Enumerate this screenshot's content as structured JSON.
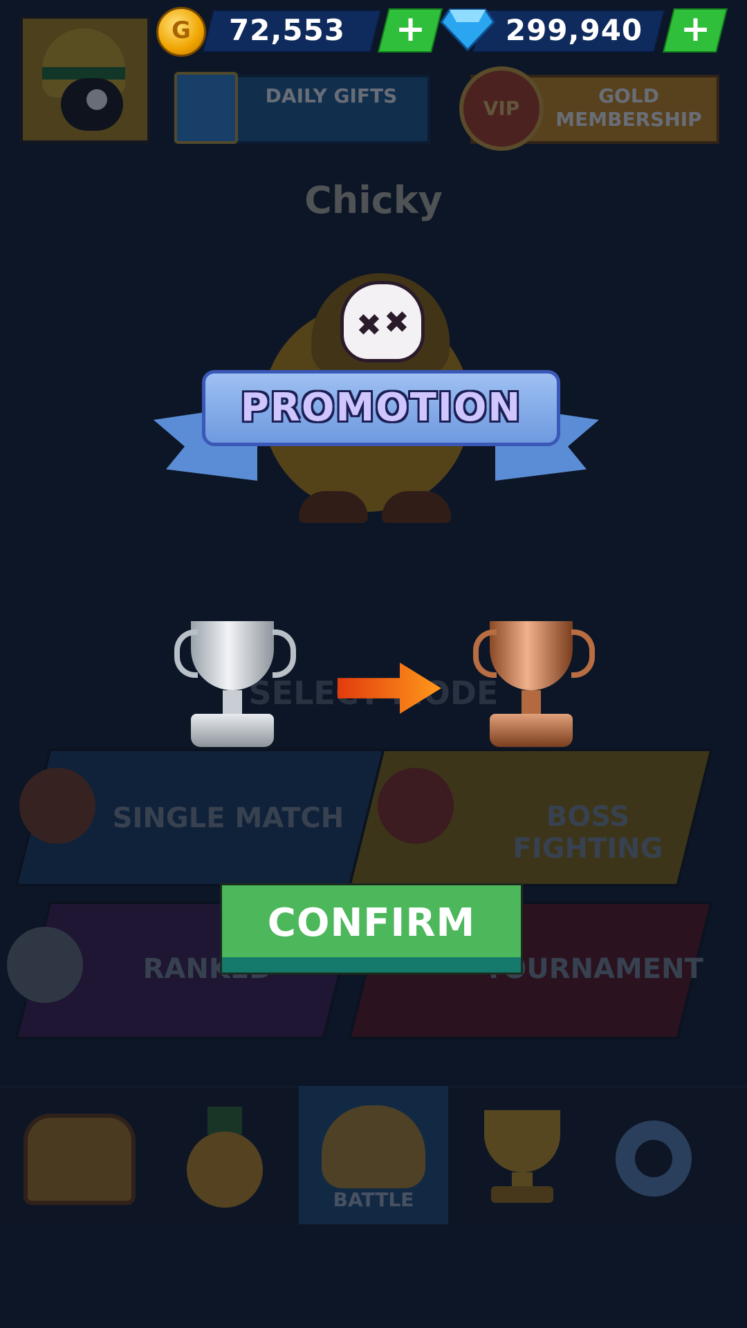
{
  "currency": {
    "coins": "72,553",
    "gems": "299,940",
    "plus_label": "+"
  },
  "header": {
    "daily_gifts": "DAILY GIFTS",
    "vip_badge": "VIP",
    "gold_membership": "GOLD MEMBERSHIP"
  },
  "character": {
    "name": "Chicky"
  },
  "promotion": {
    "title": "PROMOTION",
    "from_rank_icon": "silver-trophy-icon",
    "to_rank_icon": "bronze-trophy-icon"
  },
  "modes": {
    "section_title": "SELECT MODE",
    "single_match": "SINGLE MATCH",
    "boss_fighting": "BOSS FIGHTING",
    "ranked": "RANKED",
    "tournament": "TOURNAMENT"
  },
  "confirm_label": "CONFIRM",
  "nav": {
    "battle_label": "BATTLE",
    "items": [
      "treasure-chest-icon",
      "medal-icon",
      "battle-icon",
      "trophy-icon",
      "settings-gear-icon"
    ]
  },
  "colors": {
    "confirm": "#4cb75b",
    "ribbon": "#6f9ae0",
    "plus": "#2fbf3a"
  }
}
